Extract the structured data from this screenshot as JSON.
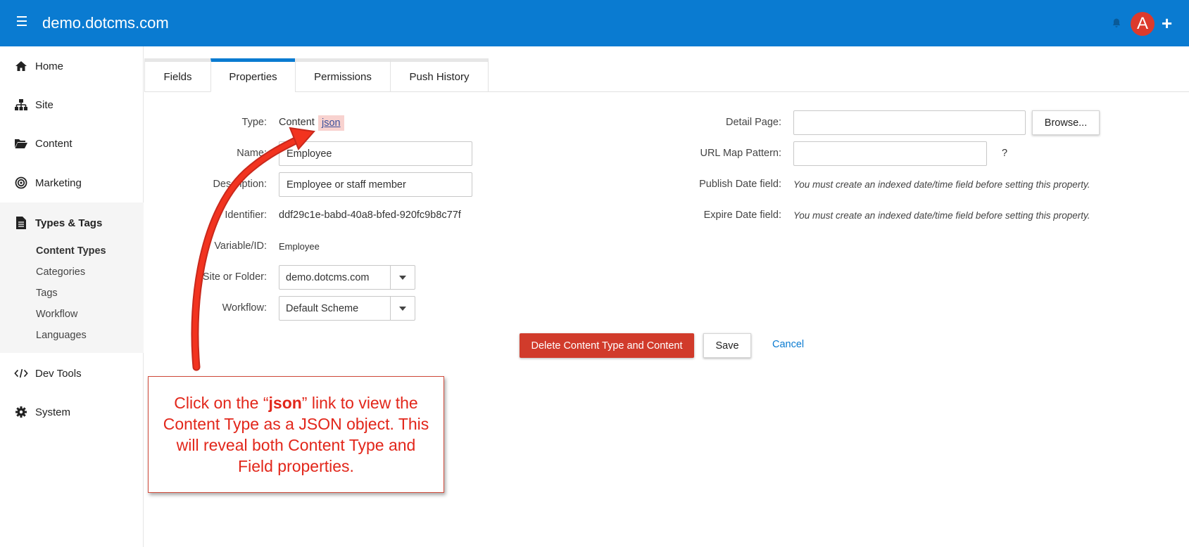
{
  "header": {
    "site_title": "demo.dotcms.com",
    "avatar_letter": "A",
    "plus_label": "+"
  },
  "sidebar": {
    "items": [
      {
        "label": "Home",
        "icon": "home-icon"
      },
      {
        "label": "Site",
        "icon": "sitemap-icon"
      },
      {
        "label": "Content",
        "icon": "folder-open-icon"
      },
      {
        "label": "Marketing",
        "icon": "target-icon"
      },
      {
        "label": "Types & Tags",
        "icon": "document-icon"
      },
      {
        "label": "Dev Tools",
        "icon": "code-icon"
      },
      {
        "label": "System",
        "icon": "gear-icon"
      }
    ],
    "sub_items": [
      "Content Types",
      "Categories",
      "Tags",
      "Workflow",
      "Languages"
    ]
  },
  "tabs": [
    "Fields",
    "Properties",
    "Permissions",
    "Push History"
  ],
  "form": {
    "type_label": "Type:",
    "type_value": "Content",
    "json_link": "json",
    "name_label": "Name:",
    "name_value": "Employee",
    "description_label": "Description:",
    "description_value": "Employee or staff member",
    "identifier_label": "Identifier:",
    "identifier_value": "ddf29c1e-babd-40a8-bfed-920fc9b8c77f",
    "variable_label": "Variable/ID:",
    "variable_value": "Employee",
    "site_label": "Site or Folder:",
    "site_value": "demo.dotcms.com",
    "workflow_label": "Workflow:",
    "workflow_value": "Default Scheme",
    "detail_page_label": "Detail Page:",
    "detail_page_value": "",
    "browse_label": "Browse...",
    "url_map_label": "URL Map Pattern:",
    "url_map_value": "",
    "url_map_help": "?",
    "publish_label": "Publish Date field:",
    "publish_hint": "You must create an indexed date/time field before setting this property.",
    "expire_label": "Expire Date field:",
    "expire_hint": "You must create an indexed date/time field before setting this property."
  },
  "actions": {
    "delete_label": "Delete Content Type and Content",
    "save_label": "Save",
    "cancel_label": "Cancel"
  },
  "callout": {
    "line_before": "Click on the “",
    "bold": "json",
    "line_after": "” link to view the Content Type as a JSON object. This will reveal both Content Type and Field properties."
  },
  "colors": {
    "header_bg": "#0a7bd1",
    "accent": "#0a7bd1",
    "danger": "#d13b2b",
    "avatar": "#dc3a2c",
    "callout_text": "#e2261a"
  }
}
